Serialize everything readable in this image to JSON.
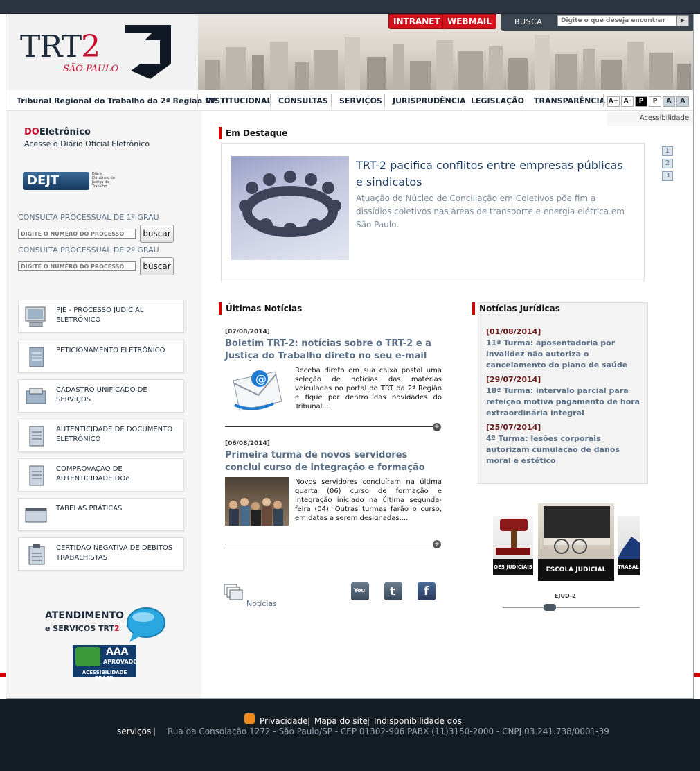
{
  "header": {
    "logo_text": "TRT",
    "logo_number": "2",
    "logo_city": "SÃO PAULO",
    "intranet": "INTRANET",
    "webmail": "WEBMAIL",
    "search_label": "BUSCA",
    "search_placeholder": "Digite o que deseja encontrar"
  },
  "nav": {
    "brand": "Tribunal Regional do Trabalho da 2ª Região SP",
    "items": [
      "INSTITUCIONAL",
      "CONSULTAS",
      "SERVIÇOS",
      "JURISPRUDÊNCIA",
      "LEGISLAÇÃO",
      "TRANSPARÊNCIA"
    ],
    "font_controls": [
      "A+",
      "A-",
      "P",
      "P",
      "A",
      "A"
    ],
    "accessibility": "Acessibilidade"
  },
  "sidebar": {
    "do_prefix": "DO",
    "do_title": "Eletrônico",
    "do_sub": "Acesse o Diário Oficial Eletrônico",
    "dejt": "DEJT",
    "dejt_caption": "Diário Eletrônico da Justiça do Trabalho",
    "cp1_label": "CONSULTA PROCESSUAL DE 1º GRAU",
    "cp2_label": "CONSULTA PROCESSUAL DE 2º GRAU",
    "cp_placeholder": "DIGITE O NÚMERO DO PROCESSO",
    "cp_button": "buscar",
    "services": [
      "PJE - PROCESSO JUDICIAL ELETRÔNICO",
      "PETICIONAMENTO ELETRÔNICO",
      "CADASTRO UNIFICADO DE SERVIÇOS",
      "AUTENTICIDADE DE DOCUMENTO ELETRÔNICO",
      "COMPROVAÇÃO DE AUTENTICIDADE DOe",
      "TABELAS PRÁTICAS",
      "CERTIDÃO NEGATIVA DE DÉBITOS TRABALHISTAS"
    ],
    "atend_title": "ATENDIMENTO",
    "atend_sub_prefix": "e SERVIÇOS",
    "atend_sub_brand": "TRT",
    "atend_sub_num": "2",
    "aaa_badge": "AAA",
    "aaa_status": "APROVADO",
    "aaa_caption": "ACESSIBILIDADE BRASIL"
  },
  "destaque": {
    "heading": "Em Destaque",
    "title": "TRT-2 pacifica conflitos entre empresas públicas e sindicatos",
    "text": "Atuação do Núcleo de Conciliação em Coletivos põe fim a dissídios coletivos nas áreas de transporte e energia elétrica em São Paulo.",
    "pages": [
      "1",
      "2",
      "3"
    ]
  },
  "noticias": {
    "heading": "Últimas Notícias",
    "items": [
      {
        "date": "[07/08/2014]",
        "title": "Boletim TRT-2: notícias sobre o TRT-2 e a Justiça do Trabalho direto no seu e-mail",
        "body": "Receba direto em sua caixa postal uma seleção de notícias das matérias veiculadas no portal do TRT da 2ª Região e fique por dentro das novidades do Tribunal...."
      },
      {
        "date": "[06/08/2014]",
        "title": "Primeira turma de novos servidores conclui curso de integração e formação",
        "body": "Novos servidores concluíram na última quarta (06) curso de formação e integração iniciado na última segunda-feira (04). Outras turmas farão o curso, em datas a serem designadas...."
      }
    ],
    "more_label": "Notícias"
  },
  "juridicas": {
    "heading": "Notícias Jurídicas",
    "items": [
      {
        "date": "[01/08/2014]",
        "title": "11ª Turma: aposentadoria por invalidez não autoriza o cancelamento do plano de saúde"
      },
      {
        "date": "[29/07/2014]",
        "title": "18ª Turma: intervalo parcial para refeição motiva pagamento de hora extraordinária integral"
      },
      {
        "date": "[25/07/2014]",
        "title": "4ª Turma: lesões corporais autorizam cumulação de danos moral e estético"
      }
    ]
  },
  "carousel": {
    "slides": [
      "ÕES JUDICIAIS",
      "ESCOLA JUDICIAL",
      "TRABAL"
    ],
    "label": "EJUD-2"
  },
  "footer": {
    "links": [
      "Privacidade",
      "Mapa do site",
      "Indisponibilidade dos",
      "serviços"
    ],
    "address": "Rua da Consolação 1272 - São Paulo/SP - CEP 01302-906 PABX (11)3150-2000 - CNPJ 03.241.738/0001-39"
  },
  "colors": {
    "brand_red": "#d40000",
    "navy": "#1c2a3a",
    "link_blue": "#5a6f85"
  }
}
